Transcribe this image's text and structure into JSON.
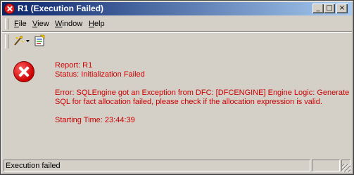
{
  "window": {
    "title": "R1 (Execution Failed)",
    "controls": {
      "minimize": "_",
      "restore": "□",
      "close": "×"
    }
  },
  "menu": {
    "items": [
      {
        "label": "File",
        "underline": "F"
      },
      {
        "label": "View",
        "underline": "V"
      },
      {
        "label": "Window",
        "underline": "W"
      },
      {
        "label": "Help",
        "underline": "H"
      }
    ]
  },
  "toolbar": {
    "tools": [
      {
        "icon": "wand-dropdown-icon"
      },
      {
        "icon": "export-report-icon"
      }
    ]
  },
  "report": {
    "icon": "error-icon",
    "lines": {
      "report": "Report: R1",
      "status": "Status: Initialization Failed",
      "error_line1": "Error: SQLEngine got an Exception from DFC: [DFCENGINE] Engine Logic: Generate",
      "error_line2": "SQL for fact allocation failed, please check if the allocation expression is valid.",
      "starting_time": "Starting Time: 23:44:39"
    },
    "text_color": "#cc0000"
  },
  "statusbar": {
    "text": "Execution failed"
  }
}
